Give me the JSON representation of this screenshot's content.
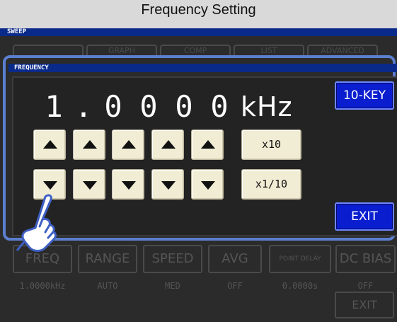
{
  "title": "Frequency Setting",
  "sweep_header": "SWEEP",
  "background_tabs": [
    "",
    "GRAPH",
    "COMP",
    "LIST",
    "ADVANCED"
  ],
  "dialog": {
    "header": "FREQUENCY",
    "digits": [
      "1",
      ".",
      "0",
      "0",
      "0",
      "0"
    ],
    "unit": "kHz",
    "ten_key_label": "10-KEY",
    "x10_label": "x10",
    "x1_10_label": "x1/10",
    "exit_label": "EXIT"
  },
  "background_params": [
    {
      "label": "FREQ",
      "value": "1.0000kHz"
    },
    {
      "label": "RANGE",
      "value": "AUTO"
    },
    {
      "label": "SPEED",
      "value": "MED"
    },
    {
      "label": "AVG",
      "value": "OFF"
    },
    {
      "label": "POINT DELAY",
      "value": "0.0000s"
    },
    {
      "label": "DC BIAS",
      "value": "OFF"
    }
  ],
  "background_exit_label": "EXIT",
  "colors": {
    "title_bg": "#d9d9d9",
    "screen_bg": "#2b2b2b",
    "header_blue": "#0a2a8a",
    "dialog_border": "#5b7fcf",
    "button_cream": "#f1ecd4",
    "button_blue": "#0a1ecf"
  },
  "icons": {
    "up_arrow": "up-triangle",
    "down_arrow": "down-triangle",
    "pointer": "pointing-hand-icon"
  }
}
